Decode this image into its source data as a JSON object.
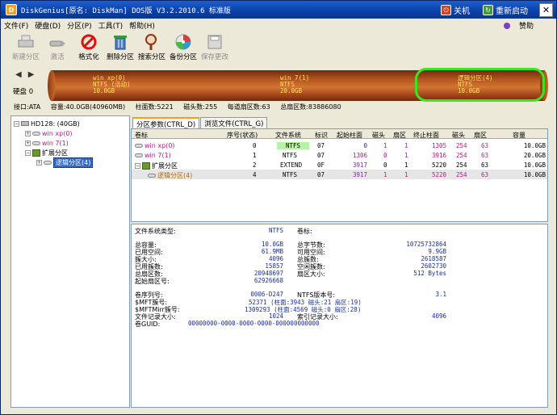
{
  "window": {
    "title": "DiskGenius[原名: DiskMan] DOS版 V3.2.2010.6 标准版",
    "shutdown_label": "关机",
    "restart_label": "重新启动",
    "close_glyph": "✕"
  },
  "menu": {
    "items": [
      "文件(F)",
      "硬盘(D)",
      "分区(P)",
      "工具(T)",
      "帮助(H)"
    ],
    "donate_label": "赞助"
  },
  "toolbar": {
    "items": [
      {
        "label": "新建分区",
        "icon": "new-partition-icon",
        "enabled": false
      },
      {
        "label": "激活",
        "icon": "activate-icon",
        "enabled": false
      },
      {
        "label": "格式化",
        "icon": "format-icon",
        "enabled": true
      },
      {
        "label": "删除分区",
        "icon": "delete-icon",
        "enabled": true
      },
      {
        "label": "搜索分区",
        "icon": "search-icon",
        "enabled": true
      },
      {
        "label": "备份分区",
        "icon": "backup-icon",
        "enabled": true
      },
      {
        "label": "保存更改",
        "icon": "save-icon",
        "enabled": false
      }
    ]
  },
  "diskmap": {
    "disk_label": "硬盘 0",
    "segments": [
      {
        "name": "win xp(0)",
        "fs": "NTFS (活动)",
        "size": "10.0GB"
      },
      {
        "name": "win 7(1)",
        "fs": "NTFS",
        "size": "20.0GB"
      },
      {
        "name": "逻辑分区(4)",
        "fs": "NTFS",
        "size": "10.0GB"
      }
    ]
  },
  "diskinfo": {
    "interface": "接口:ATA",
    "capacity": "容量:40.0GB(40960MB)",
    "cylinders": "柱面数:5221",
    "heads": "磁头数:255",
    "sectors_per_track": "每道扇区数:63",
    "total_sectors": "总扇区数:83886080"
  },
  "tree": {
    "disk": "HD128: (40GB)",
    "items": [
      "win xp(0)",
      "win 7(1)",
      "扩展分区",
      "逻辑分区(4)"
    ]
  },
  "tabs": [
    "分区参数(CTRL_D)",
    "浏览文件(CTRL_G)"
  ],
  "table": {
    "headers": [
      "卷标",
      "序号(状态)",
      "文件系统",
      "标识",
      "起始柱面",
      "磁头",
      "扇区",
      "终止柱面",
      "磁头",
      "扇区",
      "容量"
    ],
    "rows": [
      {
        "name": "win xp(0)",
        "seq": "0",
        "fs": "NTFS",
        "id": "07",
        "start_cyl": "0",
        "start_head": "1",
        "start_sec": "1",
        "end_cyl": "1305",
        "end_head": "254",
        "end_sec": "63",
        "size": "10.0GB"
      },
      {
        "name": "win 7(1)",
        "seq": "1",
        "fs": "NTFS",
        "id": "07",
        "start_cyl": "1306",
        "start_head": "0",
        "start_sec": "1",
        "end_cyl": "3916",
        "end_head": "254",
        "end_sec": "63",
        "size": "20.0GB"
      },
      {
        "name": "扩展分区",
        "seq": "2",
        "fs": "EXTEND",
        "id": "0F",
        "start_cyl": "3917",
        "start_head": "0",
        "start_sec": "1",
        "end_cyl": "5220",
        "end_head": "254",
        "end_sec": "63",
        "size": "10.0GB"
      },
      {
        "name": "逻辑分区(4)",
        "seq": "4",
        "fs": "NTFS",
        "id": "07",
        "start_cyl": "3917",
        "start_head": "1",
        "start_sec": "1",
        "end_cyl": "5220",
        "end_head": "254",
        "end_sec": "63",
        "size": "10.0GB"
      }
    ]
  },
  "details": {
    "fs_type_label": "文件系统类型:",
    "fs_type_value": "NTFS",
    "vol_label": "卷标:",
    "total_capacity_label": "总容量:",
    "total_capacity_value": "10.0GB",
    "used_label": "已用空间:",
    "used_value": "61.9MB",
    "cluster_size_label": "簇大小:",
    "cluster_size_value": "4096",
    "used_clusters_label": "已用簇数:",
    "used_clusters_value": "15857",
    "total_sectors_label": "总扇区数:",
    "total_sectors_value": "20948697",
    "start_sector_label": "起始扇区号:",
    "start_sector_value": "62926668",
    "total_bytes_label": "总字节数:",
    "total_bytes_value": "10725732864",
    "free_label": "可用空间:",
    "free_value": "9.9GB",
    "total_clusters_label": "总簇数:",
    "total_clusters_value": "2618587",
    "free_clusters_label": "空闲簇数:",
    "free_clusters_value": "2602730",
    "sector_size_label": "扇区大小:",
    "sector_size_value": "512 Bytes",
    "serial_label": "卷序列号:",
    "serial_value": "0006-D247",
    "ntfs_ver_label": "NTFS版本号:",
    "ntfs_ver_value": "3.1",
    "mft_label": "$MFT簇号:",
    "mft_value": "52371 (柱面:3943 磁头:21 扇区:19)",
    "mftmirr_label": "$MFTMirr簇号:",
    "mftmirr_value": "1309293 (柱面:4569 磁头:0 扇区:28)",
    "frs_label": "文件记录大小:",
    "frs_value": "1024",
    "index_label": "索引记录大小:",
    "index_value": "4096",
    "guid_label": "卷GUID:",
    "guid_value": "00000000-0000-0000-0000-000000000000"
  }
}
